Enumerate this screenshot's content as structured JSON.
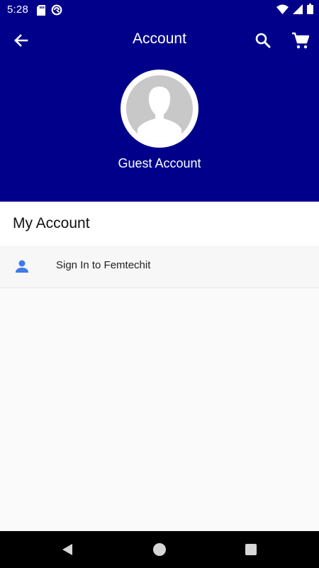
{
  "status_bar": {
    "time": "5:28",
    "icons": [
      "sd-card-icon",
      "sync-icon",
      "wifi-icon",
      "signal-icon",
      "battery-icon"
    ]
  },
  "app_bar": {
    "title": "Account",
    "icons": [
      "back-arrow-icon",
      "search-icon",
      "cart-icon"
    ]
  },
  "profile": {
    "name": "Guest Account"
  },
  "my_account": {
    "title": "My Account",
    "items": [
      {
        "label": "Sign In to Femtechit",
        "icon": "person-icon"
      }
    ]
  },
  "colors": {
    "header_bg": "#00008b",
    "content_bg": "#fafafa",
    "accent_icon": "#3d7be6"
  }
}
